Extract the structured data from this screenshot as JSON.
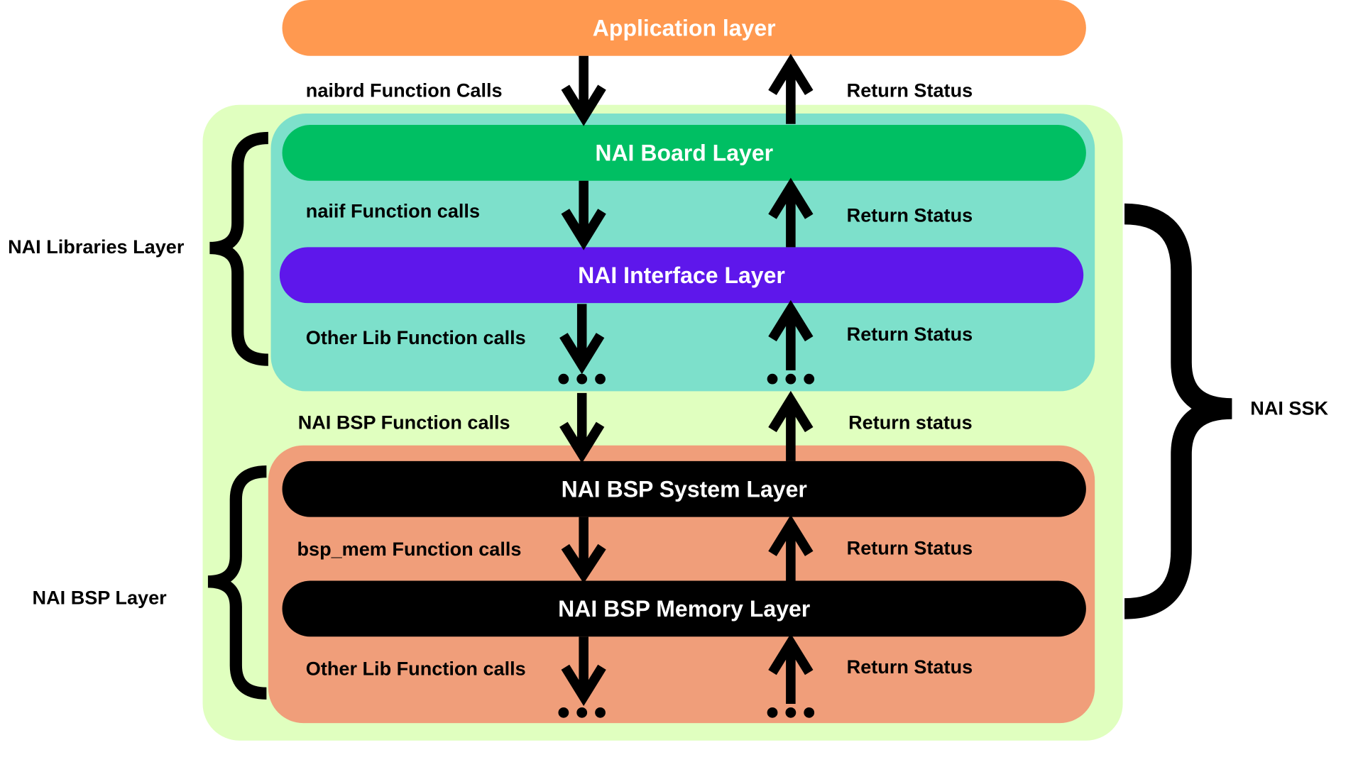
{
  "colors": {
    "application": "#FF9950",
    "outer": "#E0FFBF",
    "libraries": "#7DE0CB",
    "board": "#00BF63",
    "interface": "#5E17EB",
    "bsp": "#F09E7A",
    "bsp_layers": "#000000"
  },
  "layers": {
    "application": "Application layer",
    "board": "NAI Board Layer",
    "interface": "NAI Interface Layer",
    "bsp_system": "NAI BSP System Layer",
    "bsp_memory": "NAI BSP Memory Layer"
  },
  "calls": {
    "naibrd": "naibrd Function Calls",
    "naiif": "naiif Function calls",
    "other_lib_1": "Other Lib Function calls",
    "nai_bsp": "NAI BSP Function calls",
    "bsp_mem": "bsp_mem Function calls",
    "other_lib_2": "Other Lib Function calls"
  },
  "returns": {
    "r1": "Return Status",
    "r2": "Return Status",
    "r3": "Return Status",
    "r4": "Return status",
    "r5": "Return Status",
    "r6": "Return Status"
  },
  "groups": {
    "libraries": "NAI Libraries Layer",
    "bsp": "NAI BSP Layer",
    "ssk": "NAI SSK"
  }
}
